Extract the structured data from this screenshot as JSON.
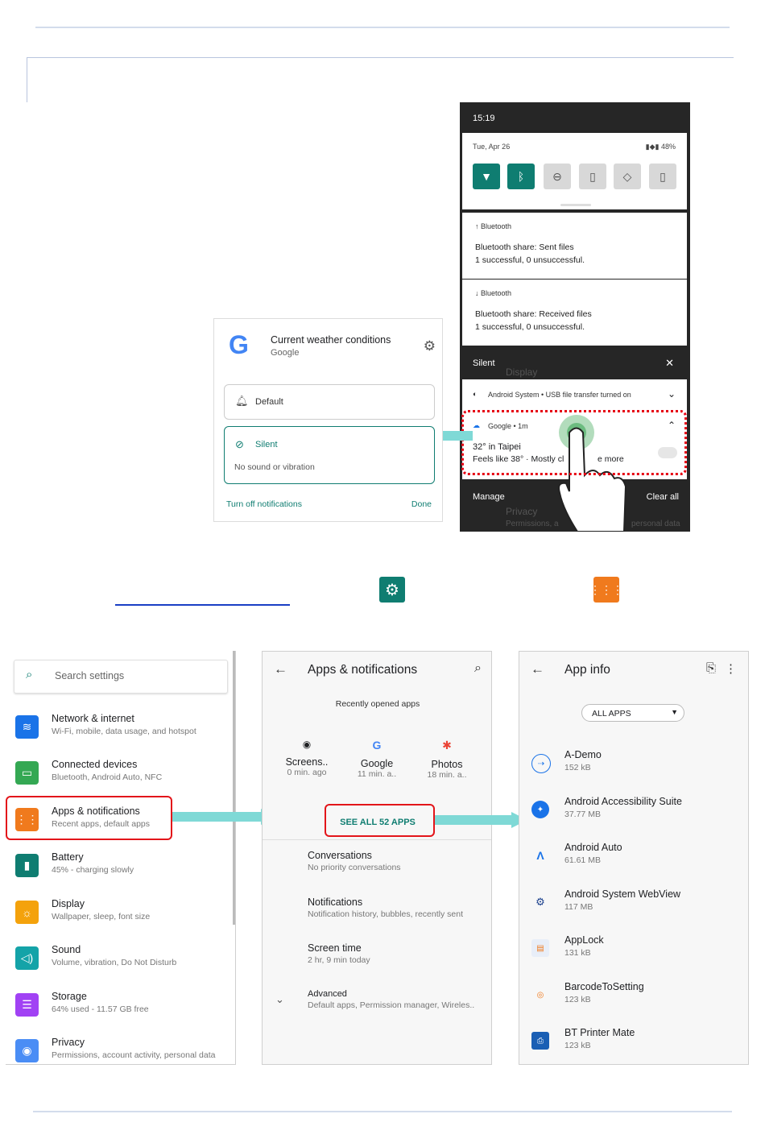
{
  "shade": {
    "time": "15:19",
    "date": "Tue, Apr 26",
    "status": "48%",
    "notif1": {
      "app": "Bluetooth",
      "title": "Bluetooth share: Sent files",
      "body": "1 successful, 0 unsuccessful."
    },
    "notif2": {
      "app": "Bluetooth",
      "title": "Bluetooth share: Received files",
      "body": "1 successful, 0 unsuccessful."
    },
    "silent_header": "Silent",
    "ghost_display": "Display",
    "system_row": "Android System • USB file transfer turned on",
    "weather": {
      "app": "Google • 1m",
      "title": "32° in Taipei",
      "body": "Feels like 38° · Mostly cl",
      "more": "e more"
    },
    "manage": "Manage",
    "clear_all": "Clear all",
    "ghost_privacy": "Privacy",
    "ghost_privacy_sub": "Permissions, a",
    "ghost_privacy_sub2": "personal data"
  },
  "popup": {
    "title": "Current weather conditions",
    "subtitle": "Google",
    "default_label": "Default",
    "silent_label": "Silent",
    "silent_desc": "No sound or vibration",
    "turn_off": "Turn off notifications",
    "done": "Done"
  },
  "settings": {
    "search_placeholder": "Search settings",
    "items": [
      {
        "title": "Network & internet",
        "sub": "Wi-Fi, mobile, data usage, and hotspot",
        "color": "#1a73e8"
      },
      {
        "title": "Connected devices",
        "sub": "Bluetooth, Android Auto, NFC",
        "color": "#34a853"
      },
      {
        "title": "Apps & notifications",
        "sub": "Recent apps, default apps",
        "color": "#f07a1d"
      },
      {
        "title": "Battery",
        "sub": "45% - charging slowly",
        "color": "#0f7d71"
      },
      {
        "title": "Display",
        "sub": "Wallpaper, sleep, font size",
        "color": "#f4a20c"
      },
      {
        "title": "Sound",
        "sub": "Volume, vibration, Do Not Disturb",
        "color": "#14a3a8"
      },
      {
        "title": "Storage",
        "sub": "64% used - 11.57 GB free",
        "color": "#a142f4"
      },
      {
        "title": "Privacy",
        "sub": "Permissions, account activity, personal data",
        "color": "#4a8df5"
      }
    ]
  },
  "apps_notifs": {
    "title": "Apps & notifications",
    "recent_header": "Recently opened apps",
    "recent": [
      {
        "name": "Screens..",
        "time": "0 min. ago"
      },
      {
        "name": "Google",
        "time": "11 min. a.."
      },
      {
        "name": "Photos",
        "time": "18 min. a.."
      }
    ],
    "see_all": "SEE ALL 52 APPS",
    "rows": [
      {
        "title": "Conversations",
        "sub": "No priority conversations"
      },
      {
        "title": "Notifications",
        "sub": "Notification history, bubbles, recently sent"
      },
      {
        "title": "Screen time",
        "sub": "2 hr, 9 min today"
      },
      {
        "title": "Advanced",
        "sub": "Default apps, Permission manager, Wireles.."
      }
    ]
  },
  "app_info": {
    "title": "App info",
    "filter": "ALL APPS",
    "apps": [
      {
        "name": "A-Demo",
        "size": "152 kB"
      },
      {
        "name": "Android Accessibility Suite",
        "size": "37.77 MB"
      },
      {
        "name": "Android Auto",
        "size": "61.61 MB"
      },
      {
        "name": "Android System WebView",
        "size": "117 MB"
      },
      {
        "name": "AppLock",
        "size": "131 kB"
      },
      {
        "name": "BarcodeToSetting",
        "size": "123 kB"
      },
      {
        "name": "BT Printer Mate",
        "size": "123 kB"
      }
    ]
  }
}
